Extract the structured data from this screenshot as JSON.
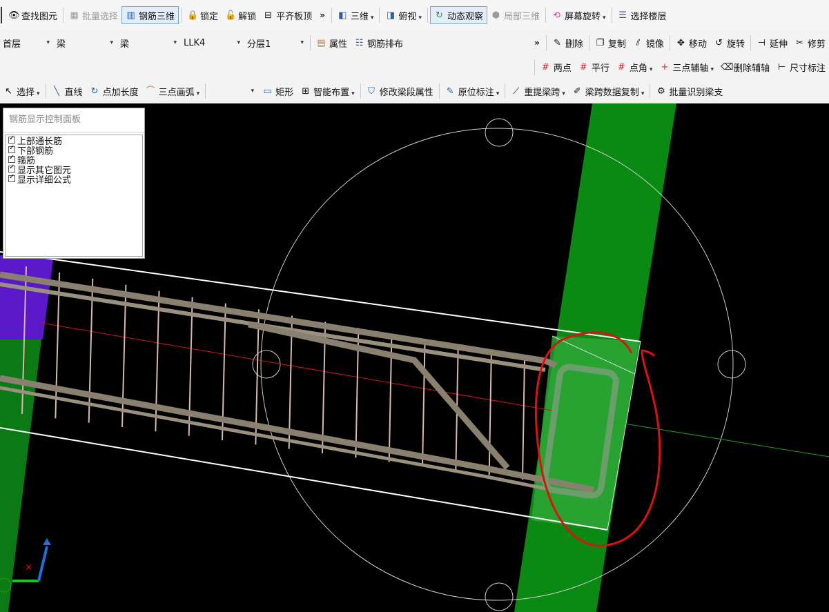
{
  "toolbar1": {
    "items": [
      {
        "label": "查找图元",
        "icon": "binoculars-icon",
        "state": "normal"
      },
      {
        "label": "批量选择",
        "icon": "batch-select-icon",
        "state": "disabled"
      },
      {
        "label": "钢筋三维",
        "icon": "rebar-3d-icon",
        "state": "active"
      },
      {
        "label": "锁定",
        "icon": "lock-icon",
        "state": "normal"
      },
      {
        "label": "解锁",
        "icon": "unlock-icon",
        "state": "normal"
      },
      {
        "label": "平齐板顶",
        "icon": "flush-slab-icon",
        "state": "normal"
      }
    ],
    "more": "»",
    "right_items": [
      {
        "label": "三维",
        "icon": "cube-3d-icon",
        "dropdown": true,
        "state": "normal"
      },
      {
        "label": "俯视",
        "icon": "top-view-icon",
        "dropdown": true,
        "state": "normal"
      },
      {
        "label": "动态观察",
        "icon": "orbit-icon",
        "dropdown": false,
        "state": "active"
      },
      {
        "label": "局部三维",
        "icon": "local-3d-icon",
        "dropdown": false,
        "state": "disabled"
      },
      {
        "label": "屏幕旋转",
        "icon": "screen-rotate-icon",
        "dropdown": true,
        "state": "normal"
      },
      {
        "label": "选择楼层",
        "icon": "floor-select-icon",
        "dropdown": false,
        "state": "normal"
      }
    ]
  },
  "toolbar2": {
    "combos": [
      {
        "value": "首层",
        "name": "floor"
      },
      {
        "value": "梁",
        "name": "element-type"
      },
      {
        "value": "梁",
        "name": "element-subtype"
      },
      {
        "value": "LLK4",
        "name": "element-name"
      },
      {
        "value": "分层1",
        "name": "layer"
      }
    ],
    "items": [
      {
        "label": "属性",
        "icon": "properties-icon"
      },
      {
        "label": "钢筋排布",
        "icon": "rebar-layout-icon"
      }
    ],
    "more": "»",
    "edit_items": [
      {
        "label": "删除",
        "icon": "delete-icon"
      },
      {
        "label": "复制",
        "icon": "copy-icon"
      },
      {
        "label": "镜像",
        "icon": "mirror-icon"
      },
      {
        "label": "移动",
        "icon": "move-icon"
      },
      {
        "label": "旋转",
        "icon": "rotate-icon"
      },
      {
        "label": "延伸",
        "icon": "extend-icon"
      },
      {
        "label": "修剪",
        "icon": "trim-icon"
      }
    ]
  },
  "toolbar3": {
    "items": [
      {
        "label": "两点",
        "icon": "two-point-axis-icon",
        "dropdown": false
      },
      {
        "label": "平行",
        "icon": "parallel-axis-icon",
        "dropdown": false
      },
      {
        "label": "点角",
        "icon": "point-angle-icon",
        "dropdown": true
      },
      {
        "label": "三点辅轴",
        "icon": "three-point-axis-icon",
        "dropdown": true
      },
      {
        "label": "删除辅轴",
        "icon": "delete-axis-icon",
        "dropdown": false
      },
      {
        "label": "尺寸标注",
        "icon": "dimension-icon",
        "dropdown": false
      }
    ]
  },
  "toolbar4": {
    "items": [
      {
        "label": "选择",
        "icon": "cursor-icon",
        "dropdown": true
      },
      {
        "label": "直线",
        "icon": "line-icon",
        "dropdown": false
      },
      {
        "label": "点加长度",
        "icon": "point-length-icon",
        "dropdown": false
      },
      {
        "label": "三点画弧",
        "icon": "arc-icon",
        "dropdown": true
      }
    ],
    "combo_value": "",
    "items2": [
      {
        "label": "矩形",
        "icon": "rectangle-icon",
        "dropdown": false
      },
      {
        "label": "智能布置",
        "icon": "smart-place-icon",
        "dropdown": true
      },
      {
        "label": "修改梁段属性",
        "icon": "edit-beam-icon",
        "dropdown": false
      },
      {
        "label": "原位标注",
        "icon": "inplace-annotation-icon",
        "dropdown": true
      },
      {
        "label": "重提梁跨",
        "icon": "beam-span-icon",
        "dropdown": true
      },
      {
        "label": "梁跨数据复制",
        "icon": "span-copy-icon",
        "dropdown": true
      },
      {
        "label": "批量识别梁支",
        "icon": "batch-identify-icon",
        "dropdown": false
      }
    ]
  },
  "panel": {
    "title": "钢筋显示控制面板",
    "options": [
      {
        "label": "上部通长筋",
        "checked": true
      },
      {
        "label": "下部钢筋",
        "checked": true
      },
      {
        "label": "箍筋",
        "checked": true
      },
      {
        "label": "显示其它图元",
        "checked": true
      },
      {
        "label": "显示详细公式",
        "checked": true
      }
    ]
  },
  "colors": {
    "viewport_bg": "#000000",
    "column_green": "#0a8a12",
    "rebar": "#8a8070",
    "annotation_red": "#e01010"
  }
}
